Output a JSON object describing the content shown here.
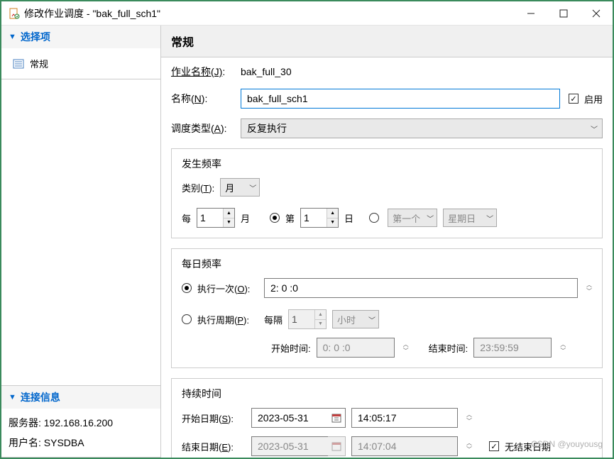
{
  "window": {
    "title": "修改作业调度 - \"bak_full_sch1\""
  },
  "sidebar": {
    "section1": {
      "title": "选择项",
      "item1": "常规"
    },
    "conn": {
      "title": "连接信息",
      "server_label": "服务器:",
      "server_value": "192.168.16.200",
      "user_label": "用户名:",
      "user_value": "SYSDBA"
    }
  },
  "main": {
    "header": "常规",
    "job_name_label": "作业名称(J):",
    "job_name_value": "bak_full_30",
    "name_label": "名称(N):",
    "name_value": "bak_full_sch1",
    "enable_label": "启用",
    "schedule_type_label": "调度类型(A):",
    "schedule_type_value": "反复执行",
    "freq": {
      "legend": "发生频率",
      "type_label": "类别(T):",
      "type_value": "月",
      "every_label": "每",
      "every_value": "1",
      "month_unit": "月",
      "nth_label": "第",
      "nth_value": "1",
      "day_unit": "日",
      "week_ordinal": "第一个",
      "weekday": "星期日"
    },
    "daily": {
      "legend": "每日频率",
      "once_label": "执行一次(O):",
      "once_value": "2: 0 :0",
      "period_label": "执行周期(P):",
      "every_label": "每隔",
      "every_value": "1",
      "unit": "小时",
      "start_label": "开始时间:",
      "start_value": "0: 0 :0",
      "end_label": "结束时间:",
      "end_value": "23:59:59"
    },
    "dur": {
      "legend": "持续时间",
      "start_date_label": "开始日期(S):",
      "start_date": "2023-05-31",
      "start_time": "14:05:17",
      "end_date_label": "结束日期(E):",
      "end_date": "2023-05-31",
      "end_time": "14:07:04",
      "no_end_label": "无结束日期"
    }
  },
  "watermark": "CSDN @youyousg"
}
